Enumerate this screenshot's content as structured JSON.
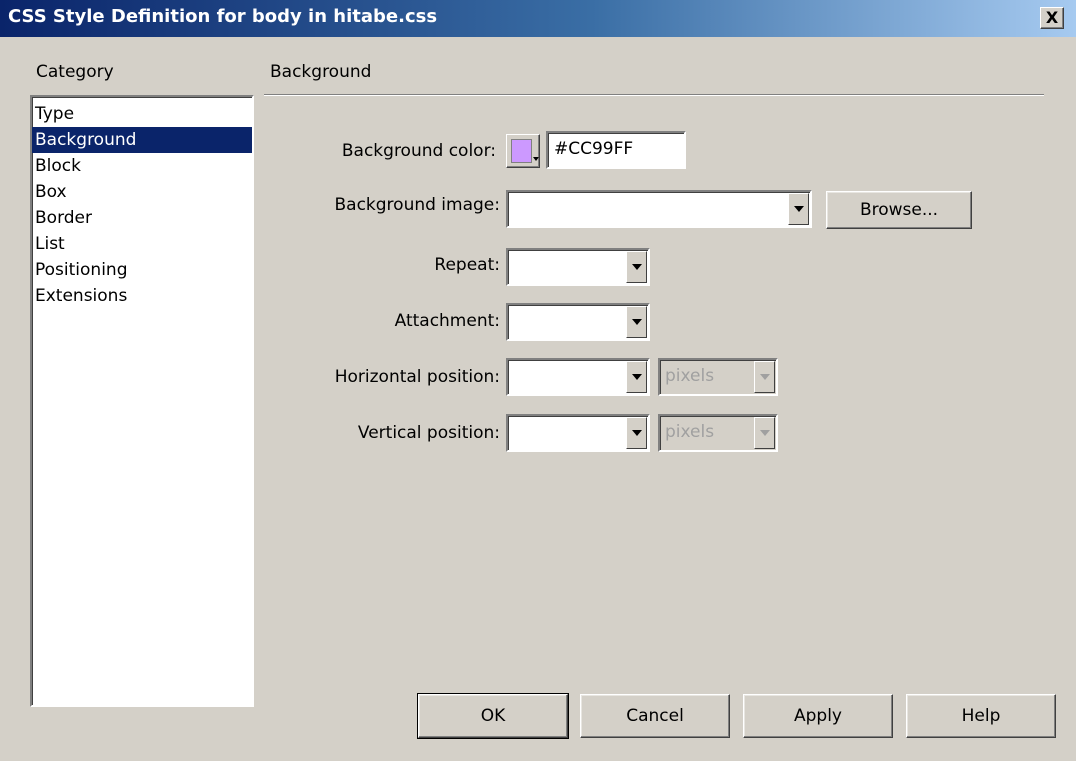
{
  "window": {
    "title": "CSS Style Definition for body in hitabe.css",
    "close_glyph": "X"
  },
  "sidebar": {
    "heading": "Category",
    "items": [
      "Type",
      "Background",
      "Block",
      "Box",
      "Border",
      "List",
      "Positioning",
      "Extensions"
    ],
    "selected": "Background"
  },
  "panel": {
    "heading": "Background",
    "background_color": {
      "label": "Background color:",
      "value": "#CC99FF",
      "swatch": "#CC99FF",
      "swatch_icon": "color-picker-swatch"
    },
    "background_image": {
      "label": "Background image:",
      "value": "",
      "browse_label": "Browse..."
    },
    "repeat": {
      "label": "Repeat:",
      "value": ""
    },
    "attachment": {
      "label": "Attachment:",
      "value": ""
    },
    "horizontal_position": {
      "label": "Horizontal position:",
      "value": "",
      "unit": "pixels"
    },
    "vertical_position": {
      "label": "Vertical position:",
      "value": "",
      "unit": "pixels"
    }
  },
  "buttons": {
    "ok": "OK",
    "cancel": "Cancel",
    "apply": "Apply",
    "help": "Help"
  },
  "colors": {
    "title_start": "#0A246A",
    "title_end": "#A6CAF0",
    "face": "#D4D0C8",
    "selection": "#0A246A"
  }
}
